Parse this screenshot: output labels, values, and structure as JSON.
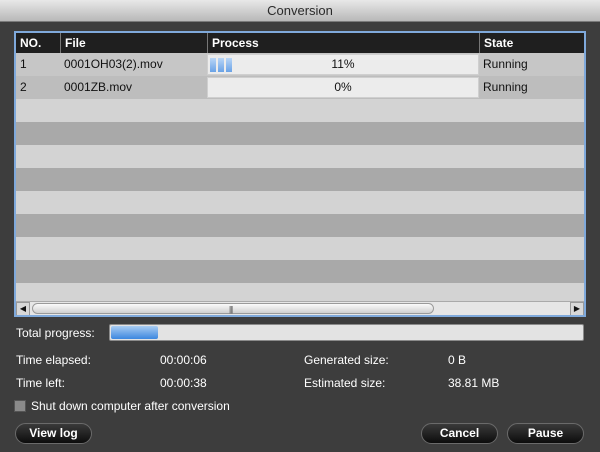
{
  "window": {
    "title": "Conversion"
  },
  "table": {
    "headers": {
      "no": "NO.",
      "file": "File",
      "process": "Process",
      "state": "State"
    },
    "rows": [
      {
        "no": "1",
        "file": "0001OH03(2).mov",
        "process_text": "11%",
        "process_fraction": 0.11,
        "state": "Running"
      },
      {
        "no": "2",
        "file": "0001ZB.mov",
        "process_text": "0%",
        "process_fraction": 0.0,
        "state": "Running"
      }
    ]
  },
  "stats": {
    "total_progress_label": "Total progress:",
    "total_progress_fraction": 0.1,
    "time_elapsed_label": "Time elapsed:",
    "time_elapsed": "00:00:06",
    "time_left_label": "Time left:",
    "time_left": "00:00:38",
    "generated_size_label": "Generated size:",
    "generated_size": "0 B",
    "estimated_size_label": "Estimated size:",
    "estimated_size": "38.81 MB"
  },
  "options": {
    "shutdown_label": "Shut down computer after conversion",
    "shutdown_checked": false
  },
  "buttons": {
    "view_log": "View log",
    "cancel": "Cancel",
    "pause": "Pause"
  },
  "colors": {
    "accent": "#3c87df",
    "panel_border": "#7fa9db"
  }
}
